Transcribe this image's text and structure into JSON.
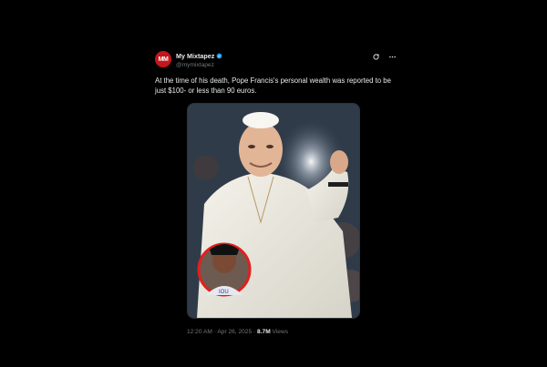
{
  "tweet": {
    "author_name": "My Mixtapez",
    "author_handle": "@mymixtapez",
    "avatar_logo": "MM",
    "text": "At the time of his death, Pope Francis's personal wealth was reported to be just $100- or less than 90 euros.",
    "time": "12:20 AM",
    "separator": "·",
    "date": "Apr 26, 2025",
    "views_count": "8.7M",
    "views_label": "Views",
    "accent_color": "#1d9bf0",
    "avatar_color": "#c4161c",
    "icons": [
      "verified-badge-icon",
      "grok-icon",
      "more-icon"
    ]
  }
}
